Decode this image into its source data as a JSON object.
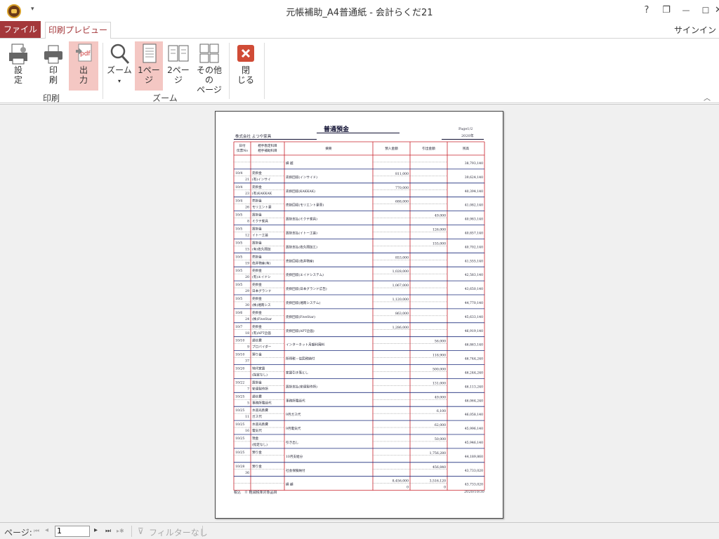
{
  "window": {
    "title": "元帳補助_A4普通紙 - 会計らくだ21",
    "help": "?",
    "restore": "❐",
    "minimize": "—",
    "maximize": "☐",
    "close": "✕",
    "qat_arrow": "▾"
  },
  "tabs": {
    "file": "ファイル",
    "print_preview": "印刷プレビュー",
    "signin": "サインイン"
  },
  "ribbon": {
    "setup": "設\n定",
    "print": "印\n刷",
    "output": "出\n力",
    "zoom": "ズーム",
    "one_page": "1ペー\nジ",
    "two_page": "2ペー\nジ",
    "more_pages": "その他の\nページ",
    "close": "閉\nじる",
    "group_print": "印刷",
    "group_zoom": "ズーム"
  },
  "report": {
    "title": "普通預金",
    "page": "Page1/2",
    "company": "株式会社 よつや家具",
    "year": "2020年",
    "headers": [
      "日付\n伝票No",
      "相手勘定科目\n相手補助科目",
      "摘要",
      "預入金額",
      "引出金額",
      "残高"
    ],
    "rows": [
      {
        "d": "",
        "n": "",
        "a1": "",
        "a2": "",
        "memo": "繰 越",
        "dep": "",
        "wd": "",
        "bal": "38,793,140"
      },
      {
        "d": "10/4",
        "n": "21",
        "a1": "売掛金",
        "a2": "(有)インサイ",
        "memo": "売掛回収(インサイド)",
        "dep": "811,000",
        "wd": "",
        "bal": "39,624,140"
      },
      {
        "d": "10/4",
        "n": "23",
        "a1": "売掛金",
        "a2": "(有)KAKKAK",
        "memo": "売掛回収(KAKKAK)",
        "dep": "770,000",
        "wd": "",
        "bal": "40,394,140"
      },
      {
        "d": "10/4",
        "n": "26",
        "a1": "売掛金",
        "a2": "モリエント豪",
        "memo": "売掛回収(モリエント豪華)",
        "dep": "688,000",
        "wd": "",
        "bal": "41,082,140"
      },
      {
        "d": "10/5",
        "n": "8",
        "a1": "買掛金",
        "a2": "ミクテ家具",
        "memo": "買掛支払(ミクテ家具)",
        "dep": "",
        "wd": "49,000",
        "bal": "40,983,140"
      },
      {
        "d": "10/5",
        "n": "12",
        "a1": "買掛金",
        "a2": "イトー工芸",
        "memo": "買掛支払(イトー工芸)",
        "dep": "",
        "wd": "126,000",
        "bal": "40,857,140"
      },
      {
        "d": "10/5",
        "n": "15",
        "a1": "買掛金",
        "a2": "(有)佐久間加",
        "memo": "買掛支払(佐久間加工)",
        "dep": "",
        "wd": "155,000",
        "bal": "40,702,140"
      },
      {
        "d": "10/5",
        "n": "19",
        "a1": "売掛金",
        "a2": "佐井物産(有)",
        "memo": "売掛回収(佐井物産)",
        "dep": "853,000",
        "wd": "",
        "bal": "41,555,140"
      },
      {
        "d": "10/5",
        "n": "20",
        "a1": "売掛金",
        "a2": "(有)エイドシ",
        "memo": "売掛回収(エイドシステム)",
        "dep": "1,028,000",
        "wd": "",
        "bal": "42,583,140"
      },
      {
        "d": "10/5",
        "n": "29",
        "a1": "売掛金",
        "a2": "日本グランド",
        "memo": "売掛回収(日本グランド広告)",
        "dep": "1,067,000",
        "wd": "",
        "bal": "43,650,140"
      },
      {
        "d": "10/5",
        "n": "30",
        "a1": "売掛金",
        "a2": "(株)湘南シス",
        "memo": "売掛回収(湘南システム)",
        "dep": "1,120,000",
        "wd": "",
        "bal": "44,770,140"
      },
      {
        "d": "10/6",
        "n": "24",
        "a1": "売掛金",
        "a2": "(株)FiveStar",
        "memo": "売掛回収(FiveStar)",
        "dep": "863,000",
        "wd": "",
        "bal": "45,633,140"
      },
      {
        "d": "10/7",
        "n": "18",
        "a1": "売掛金",
        "a2": "(有)APT企画",
        "memo": "売掛回収(APT企画)",
        "dep": "1,286,000",
        "wd": "",
        "bal": "46,919,140"
      },
      {
        "d": "10/10",
        "n": "9",
        "a1": "通信費",
        "a2": "プロバイダー",
        "memo": "インターネット月額利用料",
        "dep": "",
        "wd": "56,000",
        "bal": "46,863,140"
      },
      {
        "d": "10/10",
        "n": "37",
        "a1": "預り金",
        "a2": "",
        "memo": "所得税・住民税納付",
        "dep": "",
        "wd": "118,900",
        "bal": "46,744,240"
      },
      {
        "d": "10/20",
        "n": "",
        "a1": "地代家賃",
        "a2": "(指定なし)",
        "memo": "家賃引き落とし",
        "dep": "",
        "wd": "500,000",
        "bal": "46,244,240"
      },
      {
        "d": "10/22",
        "n": "7",
        "a1": "買掛金",
        "a2": "安達製作所",
        "memo": "買掛支払(安達製作所)",
        "dep": "",
        "wd": "131,000",
        "bal": "46,113,240"
      },
      {
        "d": "10/25",
        "n": "5",
        "a1": "通信費",
        "a2": "事務所電話代",
        "memo": "事務所電話代",
        "dep": "",
        "wd": "49,000",
        "bal": "46,064,240"
      },
      {
        "d": "10/25",
        "n": "11",
        "a1": "水道光熱費",
        "a2": "ガス代",
        "memo": "9月ガス代",
        "dep": "",
        "wd": "6,100",
        "bal": "46,058,140"
      },
      {
        "d": "10/25",
        "n": "16",
        "a1": "水道光熱費",
        "a2": "電気代",
        "memo": "9月電気代",
        "dep": "",
        "wd": "62,000",
        "bal": "45,996,140"
      },
      {
        "d": "10/25",
        "n": "",
        "a1": "現金",
        "a2": "(指定なし)",
        "memo": "引き出し",
        "dep": "",
        "wd": "50,000",
        "bal": "45,946,140"
      },
      {
        "d": "10/25",
        "n": "",
        "a1": "預り金",
        "a2": "",
        "memo": "10月支給分",
        "dep": "",
        "wd": "1,756,280",
        "bal": "44,189,860"
      },
      {
        "d": "10/28",
        "n": "36",
        "a1": "預り金",
        "a2": "",
        "memo": "社会保険納付",
        "dep": "",
        "wd": "456,840",
        "bal": "43,733,020"
      },
      {
        "d": "",
        "n": "",
        "a1": "",
        "a2": "",
        "memo": "繰 越",
        "dep": "8,456,000",
        "dep2": "0",
        "wd": "3,516,120",
        "wd2": "0",
        "bal": "43,733,020"
      }
    ],
    "footer_left": "税込　※ 軽減税率対象品目",
    "footer_right": "2020/10/30"
  },
  "status": {
    "page_label": "ページ:",
    "page_value": "1",
    "filter": "フィルターなし",
    "first": "⏮",
    "prev": "◂",
    "next": "▸",
    "last": "⏭",
    "newrec": "▸✱"
  }
}
